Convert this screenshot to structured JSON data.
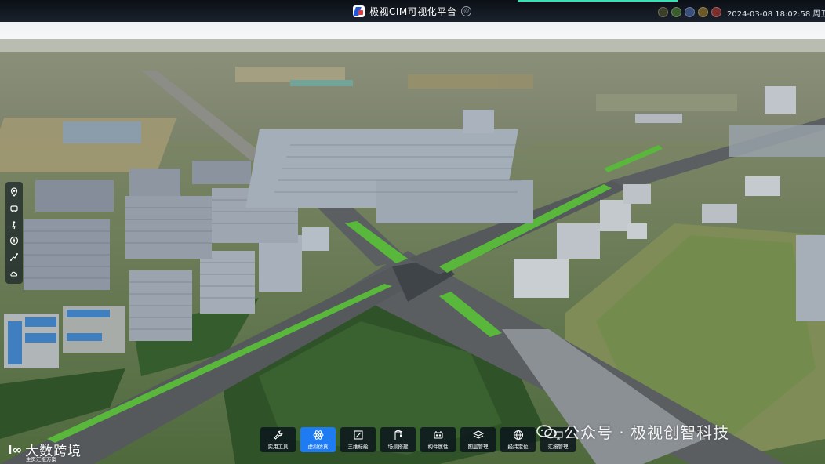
{
  "header": {
    "title": "极视CIM可视化平台",
    "title_badge": "@",
    "datetime": "2024-03-08 18:02:58 周五",
    "status_icons": [
      "weather-icon",
      "temperature-icon",
      "humidity-icon",
      "wind-icon",
      "alert-icon"
    ],
    "accent_color": "#38e0b6"
  },
  "left_tools": [
    {
      "name": "location-pin-icon"
    },
    {
      "name": "vehicle-icon"
    },
    {
      "name": "walk-icon"
    },
    {
      "name": "compass-icon"
    },
    {
      "name": "route-icon"
    },
    {
      "name": "weather-cloud-icon"
    }
  ],
  "toolbar": {
    "active_color": "#1e7bf2",
    "items": [
      {
        "label": "实用工具",
        "icon": "wrench-icon",
        "active": false
      },
      {
        "label": "虚拟仿真",
        "icon": "atom-icon",
        "active": true
      },
      {
        "label": "三维标绘",
        "icon": "draw-icon",
        "active": false
      },
      {
        "label": "场景搭建",
        "icon": "crane-icon",
        "active": false
      },
      {
        "label": "构件属性",
        "icon": "component-icon",
        "active": false
      },
      {
        "label": "图层管理",
        "icon": "layers-icon",
        "active": false
      },
      {
        "label": "经纬定位",
        "icon": "globe-icon",
        "active": false
      },
      {
        "label": "汇报管理",
        "icon": "report-icon",
        "active": false
      }
    ]
  },
  "watermark": {
    "text": "公众号 · 极视创智科技",
    "icon": "wechat-icon"
  },
  "brand": {
    "mark": "I∞",
    "text": "大数跨境",
    "subtext": "主页汇报方案"
  }
}
